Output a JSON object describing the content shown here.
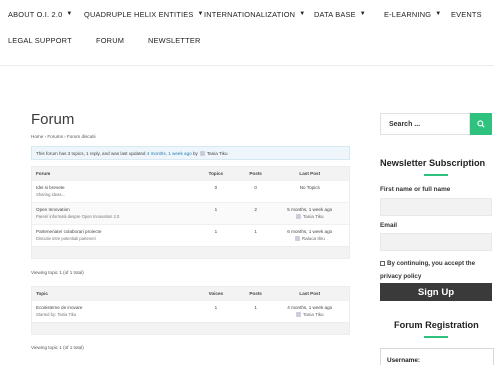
{
  "nav": {
    "row1": [
      {
        "label": "ABOUT O.I. 2.0",
        "caret": true
      },
      {
        "label": "QUADRUPLE HELIX ENTITIES",
        "caret": true
      },
      {
        "label": "INTERNATIONALIZATION",
        "caret": true
      },
      {
        "label": "DATA BASE",
        "caret": true
      },
      {
        "label": "E-LEARNING",
        "caret": true
      },
      {
        "label": "EVENTS",
        "caret": false
      }
    ],
    "row2": [
      {
        "label": "LEGAL SUPPORT"
      },
      {
        "label": "FORUM"
      },
      {
        "label": "NEWSLETTER"
      }
    ]
  },
  "main": {
    "title": "Forum",
    "breadcrumb": "Home › Forums › Forum discutii",
    "notice_prefix": "This forum has 3 topics, 1 reply, and was last updated",
    "notice_link": "4 months, 1 week ago",
    "notice_by": "by",
    "notice_user": "Tania Tiku",
    "forums_table": {
      "headers": {
        "name": "Forum",
        "a": "Topics",
        "b": "Posts",
        "last": "Last Post"
      },
      "rows": [
        {
          "title": "Idei si brevete",
          "desc": "Sharing ideas...",
          "a": "0",
          "b": "0",
          "last": "No Topics",
          "by": ""
        },
        {
          "title": "Open Innovation",
          "desc": "Pareri/ informatii despre Open Innovation 2.0",
          "a": "1",
          "b": "2",
          "last": "5 months, 1 week ago",
          "by": "Tania Tiku"
        },
        {
          "title": "Parteneriate/ colaborari proiecte",
          "desc": "Discutie intre potentiali parteneri",
          "a": "1",
          "b": "1",
          "last": "6 months, 1 week ago",
          "by": "Raluca Iliru"
        }
      ]
    },
    "viewing1": "Viewing topic 1 (of 1 total)",
    "topics_table": {
      "headers": {
        "name": "Topic",
        "a": "Voices",
        "b": "Posts",
        "last": "Last Post"
      },
      "rows": [
        {
          "title": "Ecosisteme de inovare",
          "desc": "Started by: Tania Tiku",
          "a": "1",
          "b": "1",
          "last": "4 months, 1 week ago",
          "by": "Tania Tiku"
        }
      ]
    },
    "viewing2": "Viewing topic 1 (of 1 total)"
  },
  "sidebar": {
    "search_placeholder": "Search ...",
    "search_icon": "search-icon",
    "newsletter_title": "Newsletter Subscription",
    "name_label": "First name or full name",
    "email_label": "Email",
    "consent_text": "By continuing, you accept the privacy policy",
    "signup_label": "Sign Up",
    "registration_title": "Forum Registration",
    "username_label": "Username:"
  },
  "colors": {
    "accent": "#2ec27e",
    "button_dark": "#3a3a3a",
    "notice_bg": "#eef6fb"
  }
}
